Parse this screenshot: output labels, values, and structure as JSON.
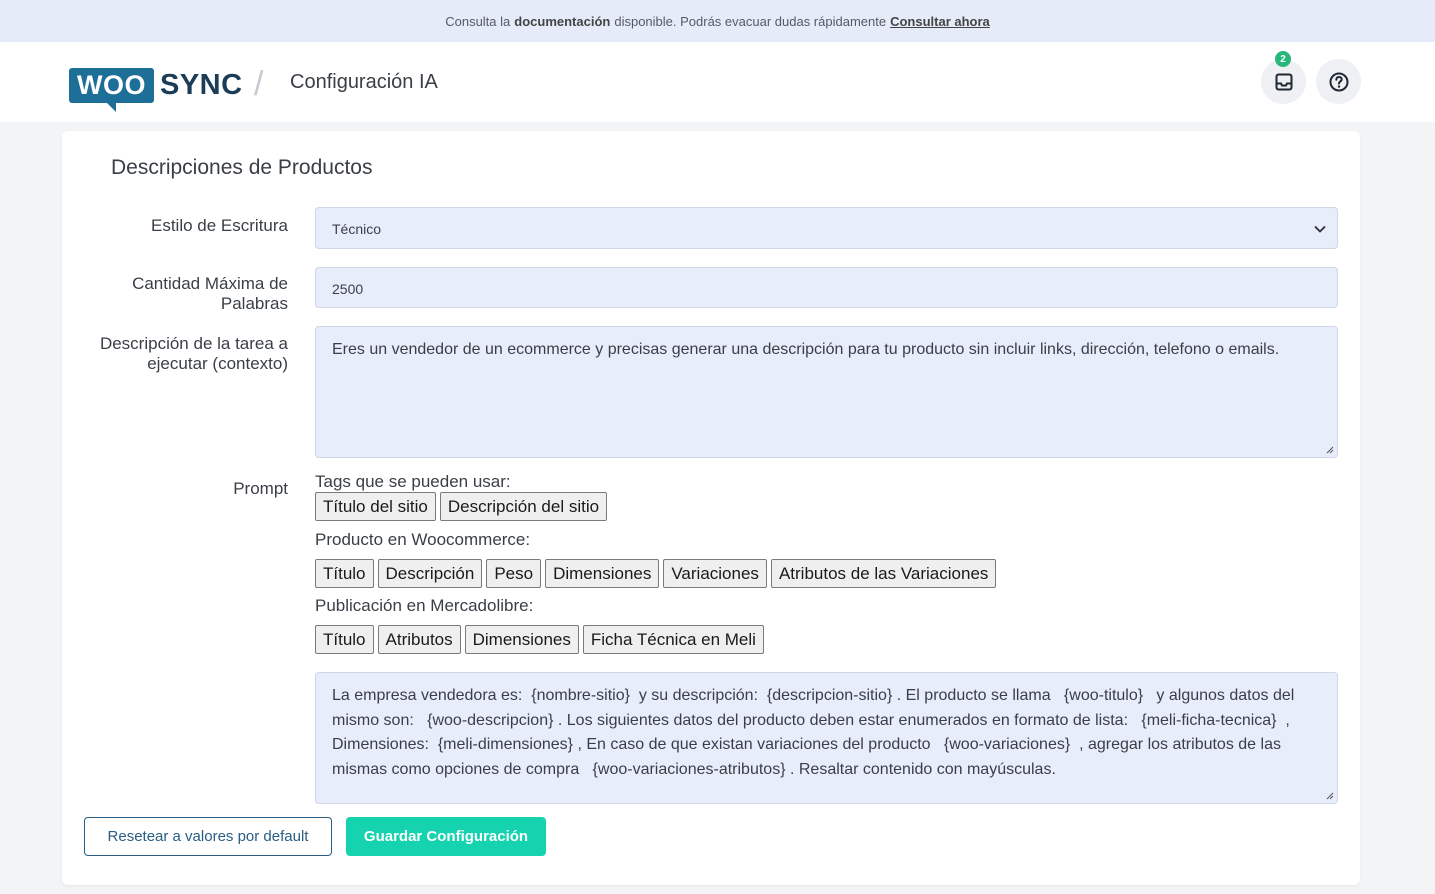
{
  "topbar": {
    "text_before": "Consulta la",
    "bold_text": "documentación",
    "text_after": "disponible. Podrás evacuar dudas rápidamente",
    "link": "Consultar ahora"
  },
  "header": {
    "logo_woo": "WOO",
    "logo_sync": "SYNC",
    "divider": "/",
    "title": "Configuración IA",
    "inbox_badge": "2"
  },
  "form": {
    "section_title": "Descripciones de Productos",
    "writing_style": {
      "label": "Estilo de Escritura",
      "value": "Técnico"
    },
    "max_words": {
      "label": "Cantidad Máxima de Palabras",
      "value": "2500"
    },
    "context": {
      "label": "Descripción de la tarea a ejecutar (contexto)",
      "value": "Eres un vendedor de un ecommerce y precisas generar una descripción para tu producto sin incluir links, dirección, telefono o emails."
    },
    "prompt": {
      "label": "Prompt",
      "site_tags_label": "Tags que se pueden usar:",
      "site_tags": [
        "Título del sitio",
        "Descripción del sitio"
      ],
      "woo_tags_label": "Producto en Woocommerce:",
      "woo_tags": [
        "Título",
        "Descripción",
        "Peso",
        "Dimensiones",
        "Variaciones",
        "Atributos de las Variaciones"
      ],
      "meli_tags_label": "Publicación en Mercadolibre:",
      "meli_tags": [
        "Título",
        "Atributos",
        "Dimensiones",
        "Ficha Técnica en Meli"
      ],
      "value": "La empresa vendedora es:  {nombre-sitio}  y su descripción:  {descripcion-sitio} . El producto se llama   {woo-titulo}   y algunos datos del mismo son:   {woo-descripcion} . Los siguientes datos del producto deben estar enumerados en formato de lista:   {meli-ficha-tecnica}  , Dimensiones:  {meli-dimensiones} , En caso de que existan variaciones del producto   {woo-variaciones}  , agregar los atributos de las mismas como opciones de compra   {woo-variaciones-atributos} . Resaltar contenido con mayúsculas."
    }
  },
  "buttons": {
    "reset": "Resetear a valores por default",
    "save": "Guardar Configuración"
  },
  "colors": {
    "topbar_bg": "#e6ebf9",
    "brand_blue": "#1e6f98",
    "save_green": "#16d3b0",
    "badge_green": "#27b879",
    "field_bg": "#e8edfb"
  }
}
